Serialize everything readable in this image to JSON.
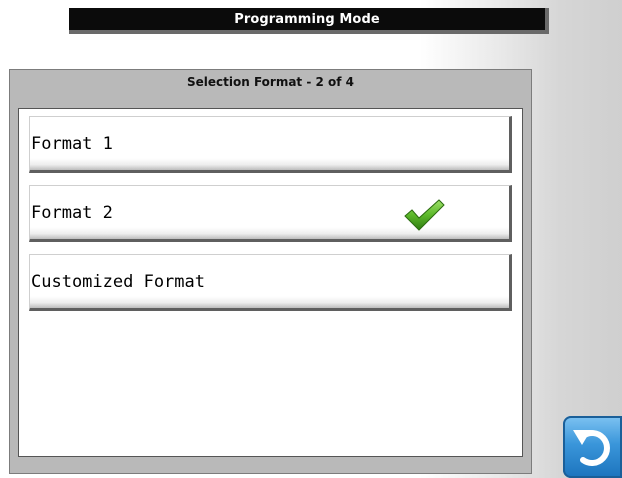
{
  "header": {
    "title": "Programming Mode"
  },
  "panel": {
    "title": "Selection Format - 2 of 4"
  },
  "options": [
    {
      "label": "Format 1",
      "selected": false
    },
    {
      "label": "Format 2",
      "selected": true
    },
    {
      "label": "Customized Format",
      "selected": false
    }
  ],
  "icons": {
    "selected": "checkmark-icon",
    "back": "back-arrow-icon"
  },
  "colors": {
    "title_bar": "#0b0b0b",
    "panel": "#b9b9b9",
    "check": "#4caf1a",
    "back_button": "#3a96da"
  }
}
